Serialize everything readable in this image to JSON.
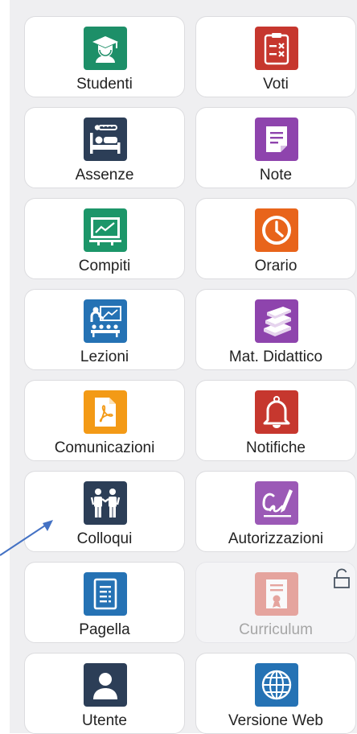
{
  "tiles": [
    {
      "label": "Studenti",
      "icon": "graduate-icon",
      "color": "#1d8f68"
    },
    {
      "label": "Voti",
      "icon": "checklist-icon",
      "color": "#c6372e"
    },
    {
      "label": "Assenze",
      "icon": "bed-thermometer-icon",
      "color": "#2c3e57"
    },
    {
      "label": "Note",
      "icon": "note-icon",
      "color": "#8e44ad"
    },
    {
      "label": "Compiti",
      "icon": "whiteboard-icon",
      "color": "#1c9669"
    },
    {
      "label": "Orario",
      "icon": "clock-icon",
      "color": "#e8641b"
    },
    {
      "label": "Lezioni",
      "icon": "classroom-icon",
      "color": "#2572b4"
    },
    {
      "label": "Mat. Didattico",
      "icon": "books-icon",
      "color": "#8e44ad"
    },
    {
      "label": "Comunicazioni",
      "icon": "pdf-document-icon",
      "color": "#f39a16"
    },
    {
      "label": "Notifiche",
      "icon": "bell-icon",
      "color": "#c6372e"
    },
    {
      "label": "Colloqui",
      "icon": "meeting-people-icon",
      "color": "#2c3e57"
    },
    {
      "label": "Autorizzazioni",
      "icon": "signature-icon",
      "color": "#9b59b6"
    },
    {
      "label": "Pagella",
      "icon": "report-card-icon",
      "color": "#2572b4"
    },
    {
      "label": "Curriculum",
      "icon": "certificate-icon",
      "color": "#d64e40",
      "disabled": true
    },
    {
      "label": "Utente",
      "icon": "user-icon",
      "color": "#2c3e57"
    },
    {
      "label": "Versione Web",
      "icon": "globe-icon",
      "color": "#2572b4"
    }
  ],
  "annotation": {
    "color": "#4472c4"
  }
}
